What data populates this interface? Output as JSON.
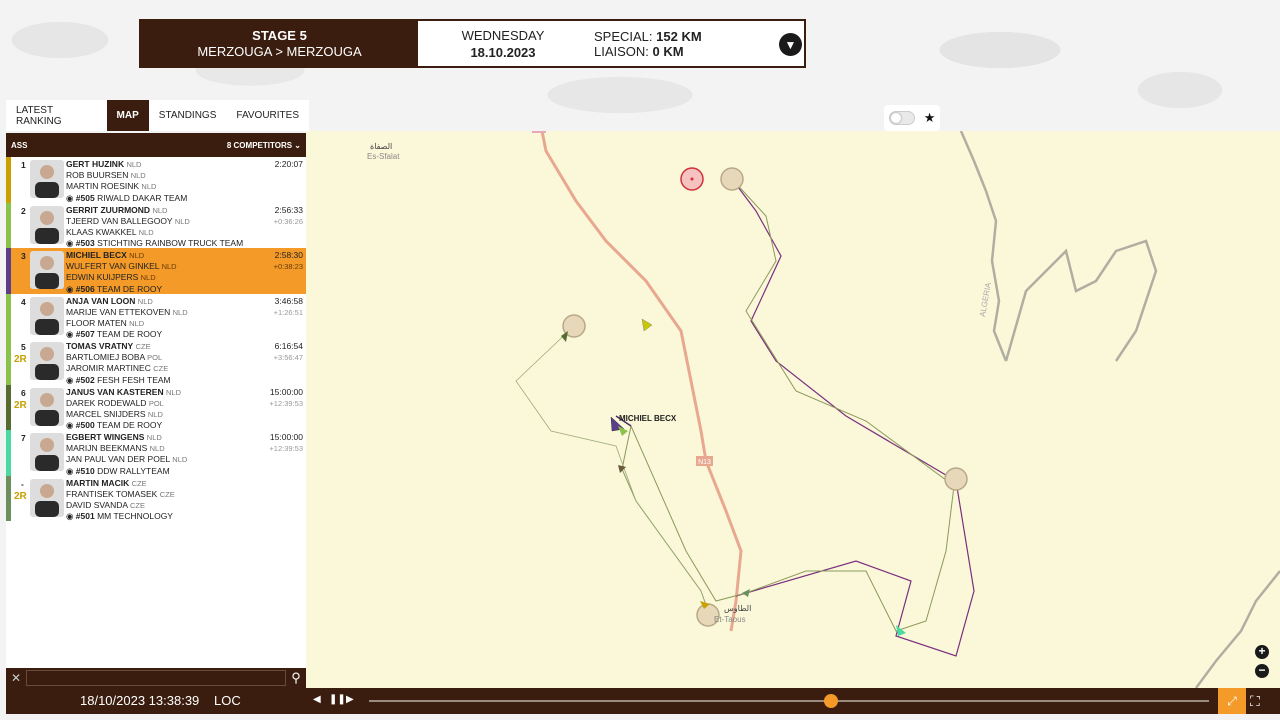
{
  "stage": {
    "title": "STAGE 5",
    "route": "MERZOUGA > MERZOUGA",
    "day": "WEDNESDAY",
    "date": "18.10.2023",
    "special_label": "SPECIAL:",
    "special_value": "152 KM",
    "liaison_label": "LIAISON:",
    "liaison_value": "0 KM"
  },
  "tabs": [
    "LATEST RANKING",
    "MAP",
    "STANDINGS",
    "FAVOURITES"
  ],
  "active_tab": "MAP",
  "list_header": {
    "class": "ASS",
    "competitors": "8 COMPETITORS"
  },
  "competitors": [
    {
      "pos": "1",
      "badge": "",
      "driver": "GERT HUZINK",
      "driver_nat": "NLD",
      "co1": "ROB BUURSEN",
      "co1_nat": "NLD",
      "co2": "MARTIN ROESINK",
      "co2_nat": "NLD",
      "num": "#505",
      "team": "RIWALD DAKAR TEAM",
      "time": "2:20:07",
      "gap": "",
      "highlight": false,
      "color": "#c8a000"
    },
    {
      "pos": "2",
      "badge": "",
      "driver": "GERRIT ZUURMOND",
      "driver_nat": "NLD",
      "co1": "TJEERD VAN BALLEGOOY",
      "co1_nat": "NLD",
      "co2": "KLAAS KWAKKEL",
      "co2_nat": "NLD",
      "num": "#503",
      "team": "STICHTING RAINBOW TRUCK TEAM",
      "time": "2:56:33",
      "gap": "+0:36:26",
      "highlight": false,
      "color": "#8bc34a"
    },
    {
      "pos": "3",
      "badge": "",
      "driver": "MICHIEL BECX",
      "driver_nat": "NLD",
      "co1": "WULFERT VAN GINKEL",
      "co1_nat": "NLD",
      "co2": "EDWIN KUIJPERS",
      "co2_nat": "NLD",
      "num": "#506",
      "team": "TEAM DE ROOY",
      "time": "2:58:30",
      "gap": "+0:38:23",
      "highlight": true,
      "color": "#5a3e8a"
    },
    {
      "pos": "4",
      "badge": "",
      "driver": "ANJA VAN LOON",
      "driver_nat": "NLD",
      "co1": "MARIJE VAN ETTEKOVEN",
      "co1_nat": "NLD",
      "co2": "FLOOR MATEN",
      "co2_nat": "NLD",
      "num": "#507",
      "team": "TEAM DE ROOY",
      "time": "3:46:58",
      "gap": "+1:26:51",
      "highlight": false,
      "color": "#8bc34a"
    },
    {
      "pos": "5",
      "badge": "2R",
      "driver": "TOMAS VRATNY",
      "driver_nat": "CZE",
      "co1": "BARTLOMIEJ BOBA",
      "co1_nat": "POL",
      "co2": "JAROMIR MARTINEC",
      "co2_nat": "CZE",
      "num": "#502",
      "team": "FESH FESH TEAM",
      "time": "6:16:54",
      "gap": "+3:56:47",
      "highlight": false,
      "color": "#8bc34a"
    },
    {
      "pos": "6",
      "badge": "2R",
      "driver": "JANUS VAN KASTEREN",
      "driver_nat": "NLD",
      "co1": "DAREK RODEWALD",
      "co1_nat": "POL",
      "co2": "MARCEL SNIJDERS",
      "co2_nat": "NLD",
      "num": "#500",
      "team": "TEAM DE ROOY",
      "time": "15:00:00",
      "gap": "+12:39:53",
      "highlight": false,
      "color": "#556b2f"
    },
    {
      "pos": "7",
      "badge": "",
      "driver": "EGBERT WINGENS",
      "driver_nat": "NLD",
      "co1": "MARIJN BEEKMANS",
      "co1_nat": "NLD",
      "co2": "JAN PAUL VAN DER POEL",
      "co2_nat": "NLD",
      "num": "#510",
      "team": "DDW RALLYTEAM",
      "time": "15:00:00",
      "gap": "+12:39:53",
      "highlight": false,
      "color": "#4cd9a0"
    },
    {
      "pos": "-",
      "badge": "2R",
      "driver": "MARTIN MACIK",
      "driver_nat": "CZE",
      "co1": "FRANTISEK TOMASEK",
      "co1_nat": "CZE",
      "co2": "DAVID SVANDA",
      "co2_nat": "CZE",
      "num": "#501",
      "team": "MM TECHNOLOGY",
      "time": "",
      "gap": "",
      "highlight": false,
      "color": "#6b8e5a"
    }
  ],
  "map": {
    "label_becx": "MICHIEL BECX",
    "place1_ar": "الصفاة",
    "place1": "Es-Sfalat",
    "place2_ar": "الطاوس",
    "place2": "Et-Taous",
    "road": "N13",
    "border": "ALGERIA",
    "zoom_in": "+",
    "zoom_out": "−"
  },
  "timebar": {
    "datetime": "18/10/2023 13:38:39",
    "zone": "LOC",
    "progress": 0.55
  },
  "colors": {
    "brand": "#3a1d0e",
    "accent": "#f39a28",
    "map_bg": "#fbf8d9"
  }
}
